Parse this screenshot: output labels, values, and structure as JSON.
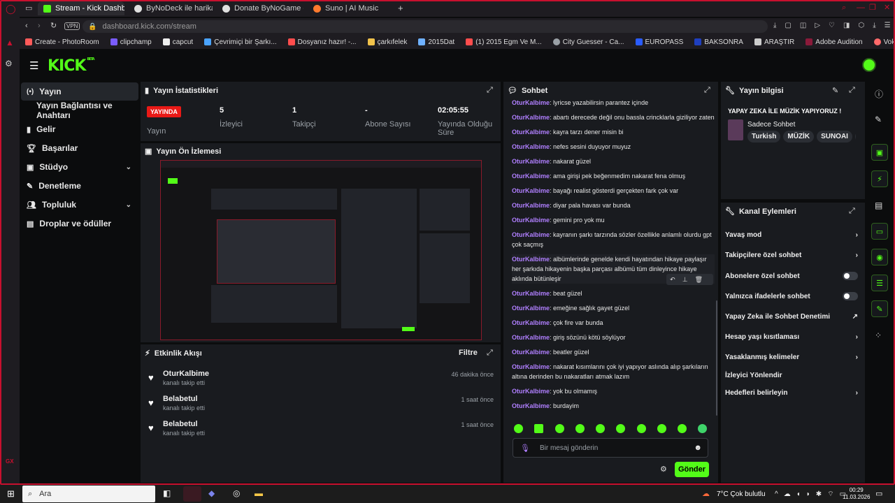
{
  "browser": {
    "tabs": [
      {
        "label": "Stream - Kick Dashboard",
        "active": true
      },
      {
        "label": "ByNoDeck ile harika kısayo",
        "active": false
      },
      {
        "label": "Donate ByNoGame - Gele",
        "active": false
      },
      {
        "label": "Suno | AI Music",
        "active": false
      }
    ],
    "vpn_label": "VPN",
    "url_host": "dashboard.kick.com",
    "url_path": "/stream",
    "bookmarks": [
      "Create - PhotoRoom",
      "clipchamp",
      "capcut",
      "Çevrimiçi bir Şarkı...",
      "Dosyanız hazır! -...",
      "çarkıfelek",
      "2015Dat",
      "(1) 2015 Egm Ve M...",
      "City Guesser - Ca...",
      "EUROPASS",
      "BAKSONRA",
      "ARAŞTIR",
      "Adobe Audition",
      "Vokal güçlendirici"
    ],
    "opera_bottom_label": "GX"
  },
  "kick": {
    "logo": "KICK",
    "logo_badge": "BETA",
    "nav": [
      {
        "label": "Yayın",
        "icon": "broadcast-icon",
        "selected": true,
        "chevron": false
      },
      {
        "label": "Yayın Bağlantısı ve Anahtarı",
        "icon": "",
        "selected": false,
        "chevron": false,
        "sub": true
      },
      {
        "label": "Gelir",
        "icon": "chart-icon",
        "selected": false,
        "chevron": false
      },
      {
        "label": "Başarılar",
        "icon": "trophy-icon",
        "selected": false,
        "chevron": false
      },
      {
        "label": "Stüdyo",
        "icon": "studio-icon",
        "selected": false,
        "chevron": true
      },
      {
        "label": "Denetleme",
        "icon": "wrench-icon",
        "selected": false,
        "chevron": false
      },
      {
        "label": "Topluluk",
        "icon": "community-icon",
        "selected": false,
        "chevron": true
      },
      {
        "label": "Droplar ve ödüller",
        "icon": "drops-icon",
        "selected": false,
        "chevron": false
      }
    ],
    "stats": {
      "title": "Yayın İstatistikleri",
      "live_badge": "YAYINDA",
      "live_label": "Yayın",
      "viewers_value": "5",
      "viewers_label": "İzleyici",
      "followers_value": "1",
      "followers_label": "Takipçi",
      "subs_value": "-",
      "subs_label": "Abone Sayısı",
      "uptime_value": "02:05:55",
      "uptime_label": "Yayında Olduğu Süre"
    },
    "preview_title": "Yayın Ön İzlemesi",
    "activity": {
      "title": "Etkinlik Akışı",
      "filter_label": "Filtre",
      "items": [
        {
          "name": "OturKalbime",
          "desc": "kanalı takip etti",
          "time": "46 dakika önce"
        },
        {
          "name": "Belabetul",
          "desc": "kanalı takip etti",
          "time": "1 saat önce"
        },
        {
          "name": "Belabetul",
          "desc": "kanalı takip etti",
          "time": "1 saat önce"
        }
      ]
    },
    "chat": {
      "title": "Sohbet",
      "messages": [
        {
          "user": "OturKalbime",
          "text": ": lyricse yazabilirsin parantez içinde"
        },
        {
          "user": "OturKalbime",
          "text": ": abartı derecede değil onu bassla crincklarla giziliyor zaten"
        },
        {
          "user": "OturKalbime",
          "text": ": kayra tarzı dener misin bi"
        },
        {
          "user": "OturKalbime",
          "text": ": nefes sesini duyuyor muyuz"
        },
        {
          "user": "OturKalbime",
          "text": ": nakarat güzel"
        },
        {
          "user": "OturKalbime",
          "text": ": ama girişi pek beğenmedim nakarat fena olmuş"
        },
        {
          "user": "OturKalbime",
          "text": ": bayağı realist gösterdi gerçekten fark çok var"
        },
        {
          "user": "OturKalbime",
          "text": ": diyar pala havası var bunda"
        },
        {
          "user": "OturKalbime",
          "text": ": gemini pro yok mu"
        },
        {
          "user": "OturKalbime",
          "text": ": kayranın şarkı tarzında sözler özellikle anlamlı olurdu gpt çok saçmış"
        },
        {
          "user": "OturKalbime",
          "text": ": albümlerinde genelde kendi hayatından hikaye paylaşır her şarkıda hikayenin başka parçası albümü tüm dinleyince hikaye aklında bütünleşir"
        },
        {
          "user": "OturKalbime",
          "text": ": beat güzel"
        },
        {
          "user": "OturKalbime",
          "text": ": emeğine sağlık gayet güzel"
        },
        {
          "user": "OturKalbime",
          "text": ": çok fire var bunda"
        },
        {
          "user": "OturKalbime",
          "text": ": giriş sözünü kötü söylüyor"
        },
        {
          "user": "OturKalbime",
          "text": ": beatler güzel"
        },
        {
          "user": "OturKalbime",
          "text": ": nakarat kısımlarını çok iyi yapıyor aslında alıp şarkıların altına derinden bu nakaratları atmak lazım"
        },
        {
          "user": "OturKalbime",
          "text": ": yok bu olmamış"
        },
        {
          "user": "OturKalbime",
          "text": ": burdayim"
        }
      ],
      "input_placeholder": "Bir mesaj gönderin",
      "send_label": "Gönder"
    },
    "stream_info": {
      "title": "Yayın bilgisi",
      "stream_title": "YAPAY ZEKA İLE MÜZİK YAPIYORUZ !",
      "category": "Sadece Sohbet",
      "tags": [
        "Turkish",
        "MÜZİK",
        "SUNOAI",
        "S"
      ]
    },
    "channel_actions": {
      "title": "Kanal Eylemleri",
      "items": [
        {
          "label": "Yavaş mod",
          "control": "chevron"
        },
        {
          "label": "Takipçilere özel sohbet",
          "control": "chevron"
        },
        {
          "label": "Abonelere özel sohbet",
          "control": "toggle",
          "state": "off"
        },
        {
          "label": "Yalnızca ifadelerle sohbet",
          "control": "toggle",
          "state": "off"
        },
        {
          "label": "Yapay Zeka ile Sohbet Denetimi",
          "control": "external"
        },
        {
          "label": "Hesap yaşı kısıtlaması",
          "control": "chevron"
        },
        {
          "label": "Yasaklanmış kelimeler",
          "control": "chevron"
        },
        {
          "label": "İzleyici Yönlendir",
          "control": "none"
        },
        {
          "label": "Hedefleri belirleyin",
          "control": "chevron"
        }
      ]
    }
  },
  "taskbar": {
    "search_placeholder": "Ara",
    "weather": "7°C Çok bulutlu",
    "time": "00:29",
    "date": "11.03.2026"
  }
}
